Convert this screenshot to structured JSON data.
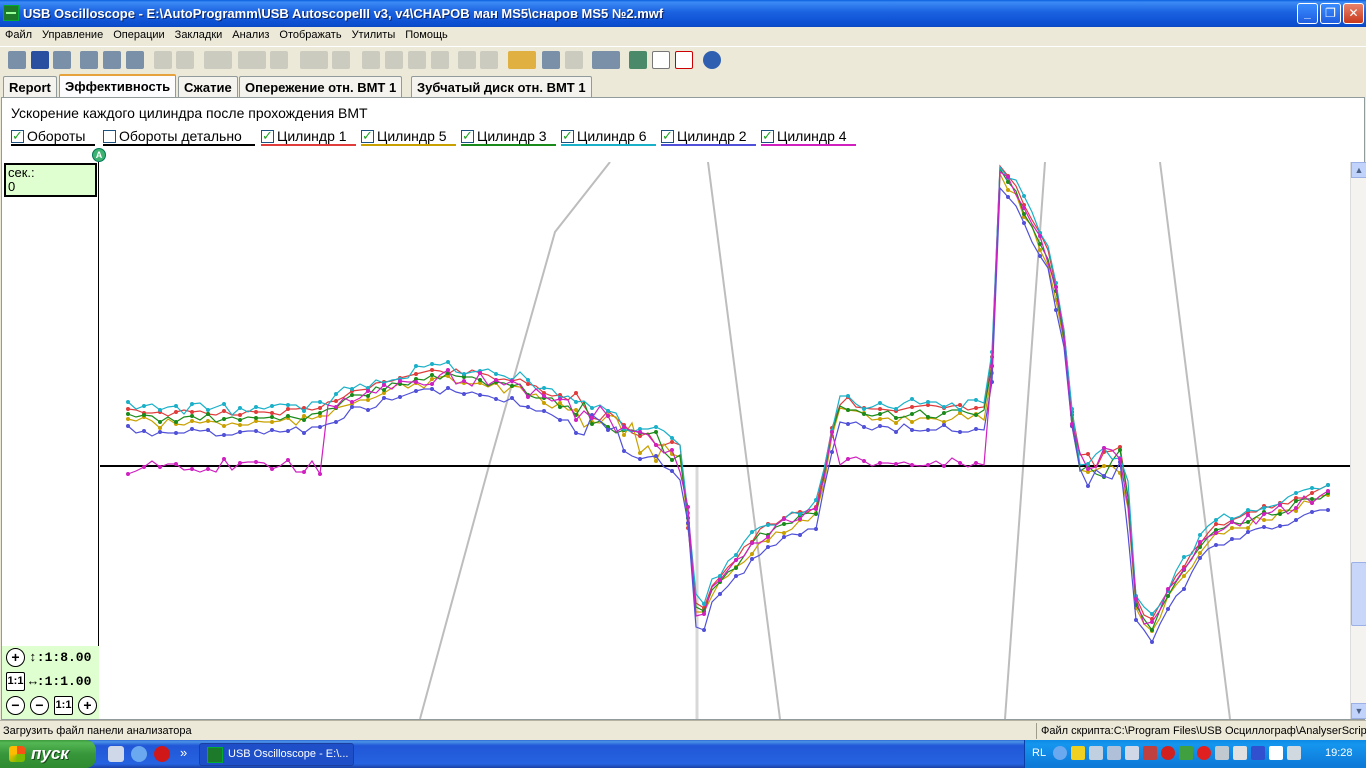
{
  "window": {
    "title": "USB Oscilloscope - E:\\AutoProgramm\\USB AutoscopeIII v3, v4\\CHAPOB ман MS5\\снаров MS5 №2.mwf",
    "minimize_label": "_",
    "maximize_label": "❐",
    "close_label": "✕"
  },
  "menu": [
    "Файл",
    "Управление",
    "Операции",
    "Закладки",
    "Анализ",
    "Отображать",
    "Утилиты",
    "Помощь"
  ],
  "tabs": [
    {
      "label": "Report",
      "active": false
    },
    {
      "label": "Эффективность",
      "active": true
    },
    {
      "label": "Сжатие",
      "active": false
    },
    {
      "label": "Опережение отн. ВМТ 1",
      "active": false
    },
    {
      "label": "Зубчатый диск отн. ВМТ 1",
      "active": false
    }
  ],
  "heading": "Ускорение каждого цилиндра после прохождения ВМТ",
  "legend": [
    {
      "label": "Обороты",
      "checked": true,
      "color": "#000000"
    },
    {
      "label": "Обороты детально",
      "checked": false,
      "color": "#000000"
    },
    {
      "label": "Цилиндр 1",
      "checked": true,
      "color": "#e03c3c"
    },
    {
      "label": "Цилиндр 5",
      "checked": true,
      "color": "#c8a000"
    },
    {
      "label": "Цилиндр 3",
      "checked": true,
      "color": "#1a8a1a"
    },
    {
      "label": "Цилиндр 6",
      "checked": true,
      "color": "#1ab0c8"
    },
    {
      "label": "Цилиндр 2",
      "checked": true,
      "color": "#5050d8"
    },
    {
      "label": "Цилиндр 4",
      "checked": true,
      "color": "#d020c0"
    }
  ],
  "marker_label": "A",
  "time_box": {
    "label": "сек.:",
    "value": "0"
  },
  "zoom": {
    "vertical_label": "↕:1:8.00",
    "horizontal_label": "↔:1:1.00",
    "plus": "+",
    "minus": "−",
    "one_to_one": "1:1"
  },
  "status": {
    "left": "Загрузить файл панели анализатора",
    "right": "Файл скрипта:C:\\Program Files\\USB Осциллограф\\AnalyserScriptf"
  },
  "taskbar": {
    "start_label": "пуск",
    "task_label": "USB Oscilloscope - E:\\...",
    "lang": "RL",
    "clock": "19:28",
    "chevron": "»"
  }
}
